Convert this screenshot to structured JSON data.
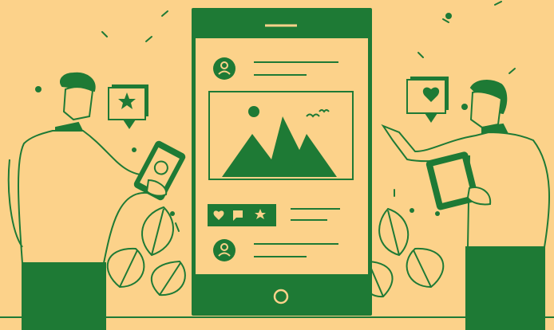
{
  "scene": {
    "description_icons": [
      "star-icon",
      "heart-icon",
      "user-avatar-icon",
      "image-placeholder-icon",
      "comment-icon",
      "birds-icon",
      "leaf-icon"
    ]
  },
  "colors": {
    "background": "#fcd28a",
    "primary_green": "#1e7a35",
    "line_green": "#1e7a35"
  },
  "phone": {
    "home_button": "circle"
  }
}
